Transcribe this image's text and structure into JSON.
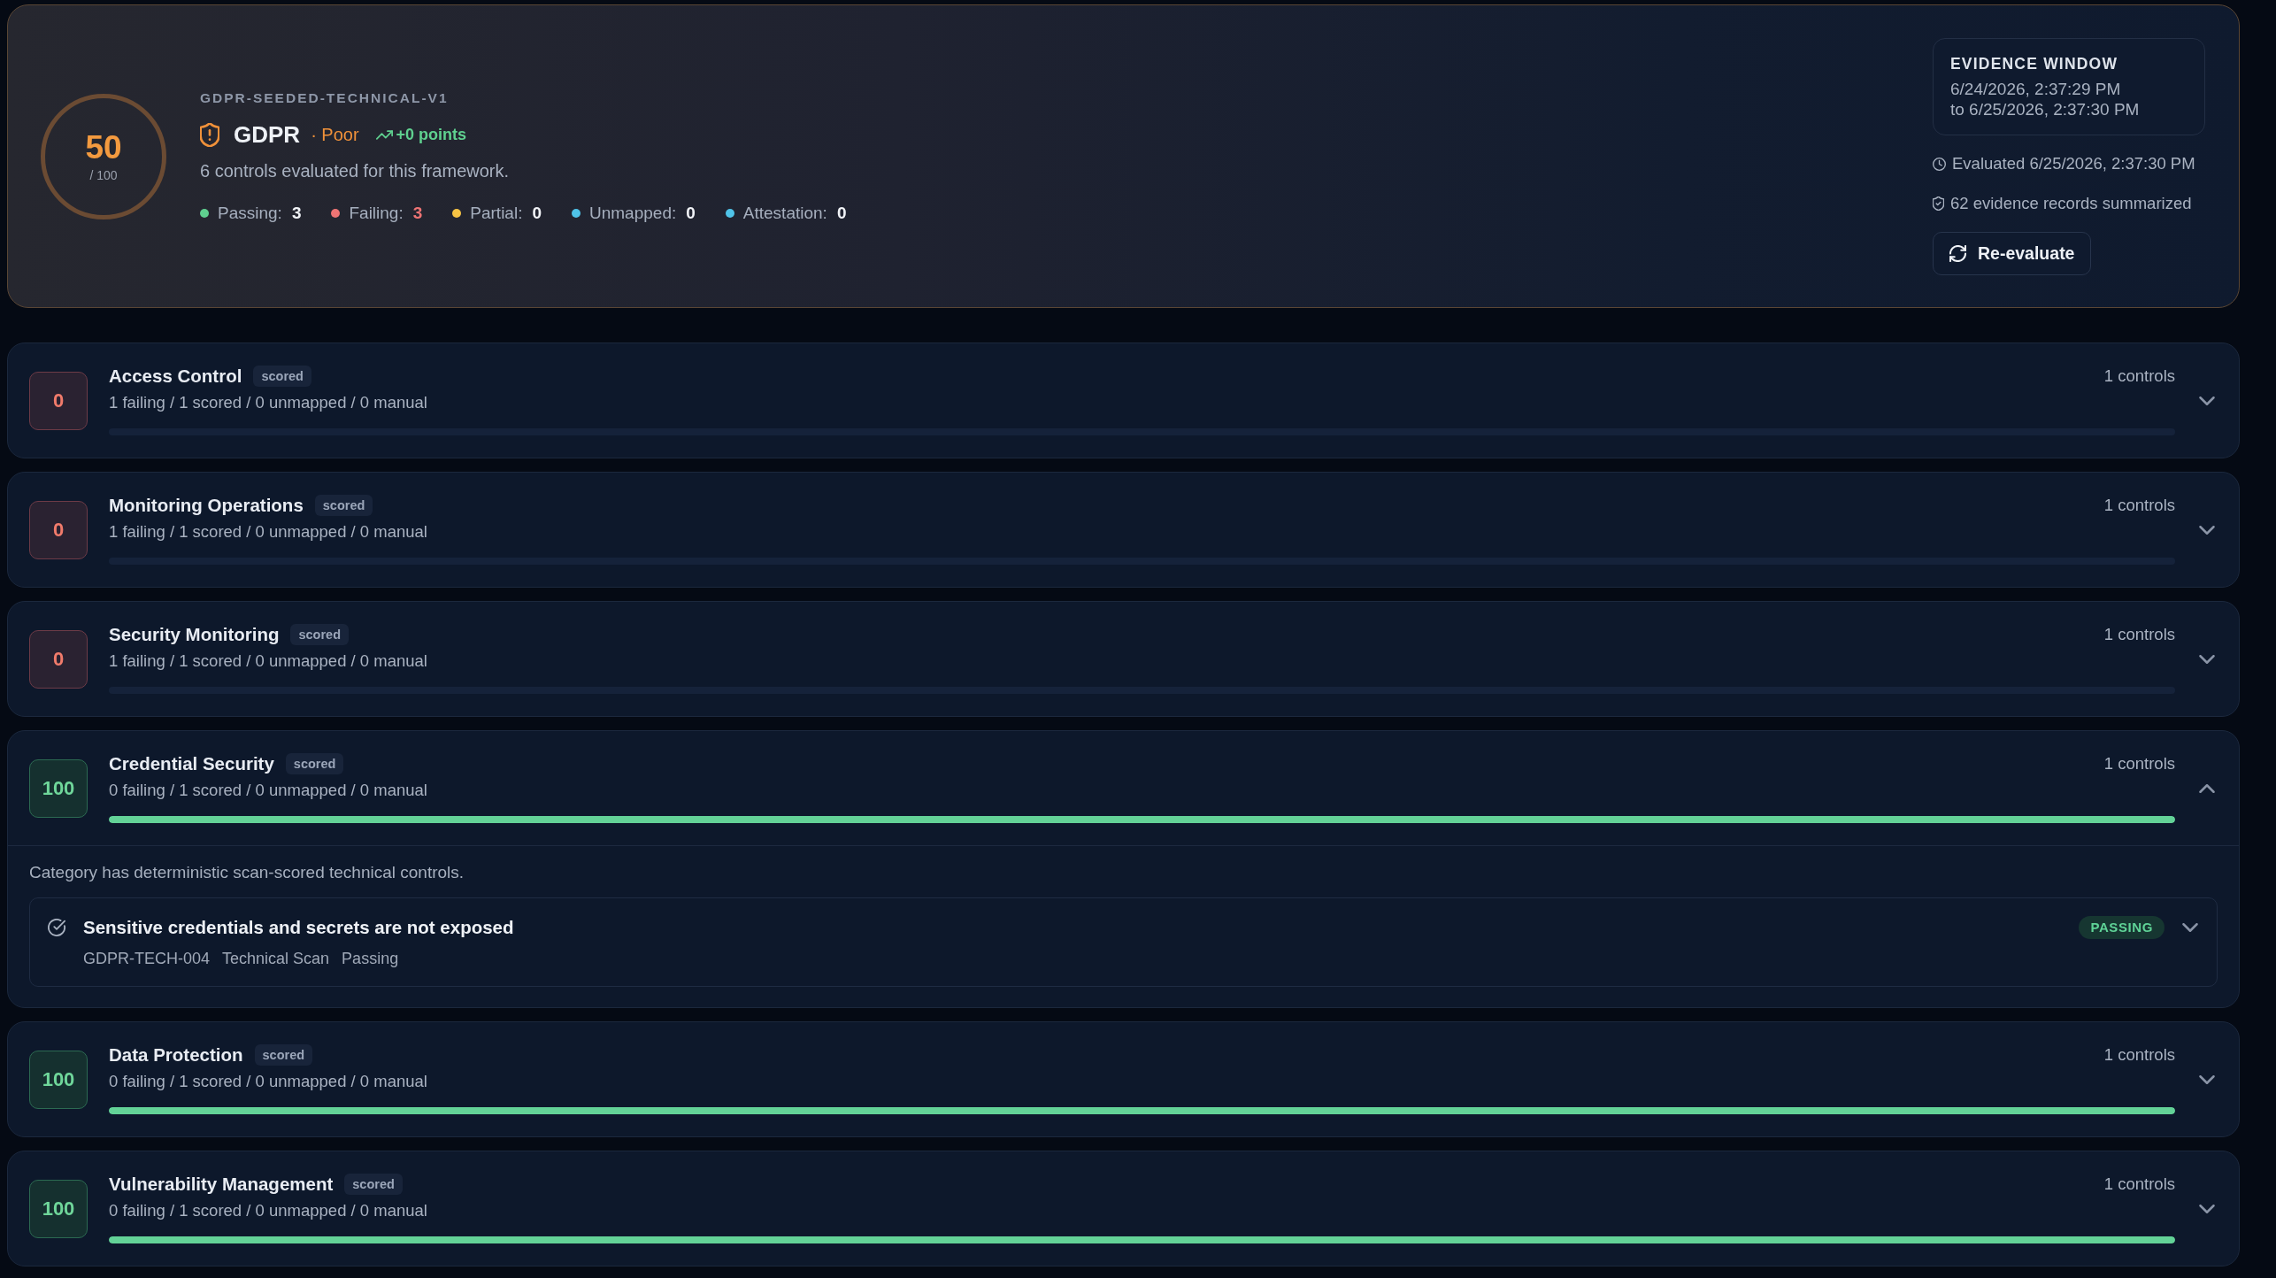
{
  "framework": {
    "code": "GDPR-SEEDED-TECHNICAL-V1",
    "score": "50",
    "score_max": "/ 100",
    "name": "GDPR",
    "rating": "· Poor",
    "trend": "+0 points",
    "description": "6 controls evaluated for this framework.",
    "stats": [
      {
        "label": "Passing:",
        "value": "3",
        "color": "#5fcf8f",
        "alert": false
      },
      {
        "label": "Failing:",
        "value": "3",
        "color": "#ee7474",
        "alert": true
      },
      {
        "label": "Partial:",
        "value": "0",
        "color": "#f6c344",
        "alert": false
      },
      {
        "label": "Unmapped:",
        "value": "0",
        "color": "#4fc3e8",
        "alert": false
      },
      {
        "label": "Attestation:",
        "value": "0",
        "color": "#4fc3e8",
        "alert": false
      }
    ]
  },
  "evidence_window": {
    "title": "EVIDENCE WINDOW",
    "start": "6/24/2026, 2:37:29 PM",
    "end": "to 6/25/2026, 2:37:30 PM"
  },
  "evaluated": "Evaluated 6/25/2026, 2:37:30 PM",
  "records": "62 evidence records summarized",
  "reevaluate_button": "Re-evaluate",
  "categories": [
    {
      "name": "Access Control",
      "tag": "scored",
      "score": "0",
      "passing": false,
      "summary": "1 failing / 1 scored / 0 unmapped / 0 manual",
      "count": "1 controls",
      "level": 0,
      "expanded": false
    },
    {
      "name": "Monitoring Operations",
      "tag": "scored",
      "score": "0",
      "passing": false,
      "summary": "1 failing / 1 scored / 0 unmapped / 0 manual",
      "count": "1 controls",
      "level": 0,
      "expanded": false
    },
    {
      "name": "Security Monitoring",
      "tag": "scored",
      "score": "0",
      "passing": false,
      "summary": "1 failing / 1 scored / 0 unmapped / 0 manual",
      "count": "1 controls",
      "level": 0,
      "expanded": false
    },
    {
      "name": "Credential Security",
      "tag": "scored",
      "score": "100",
      "passing": true,
      "summary": "0 failing / 1 scored / 0 unmapped / 0 manual",
      "count": "1 controls",
      "level": 1,
      "expanded": true,
      "note": "Category has deterministic scan-scored technical controls.",
      "controls": [
        {
          "title": "Sensitive credentials and secrets are not exposed",
          "id": "GDPR-TECH-004",
          "source": "Technical Scan",
          "result": "Passing",
          "badge": "PASSING",
          "passing": true,
          "expanded": false
        }
      ]
    },
    {
      "name": "Data Protection",
      "tag": "scored",
      "score": "100",
      "passing": true,
      "summary": "0 failing / 1 scored / 0 unmapped / 0 manual",
      "count": "1 controls",
      "level": 1,
      "expanded": false
    },
    {
      "name": "Vulnerability Management",
      "tag": "scored",
      "score": "100",
      "passing": true,
      "summary": "0 failing / 1 scored / 0 unmapped / 0 manual",
      "count": "1 controls",
      "level": 1,
      "expanded": false
    }
  ]
}
